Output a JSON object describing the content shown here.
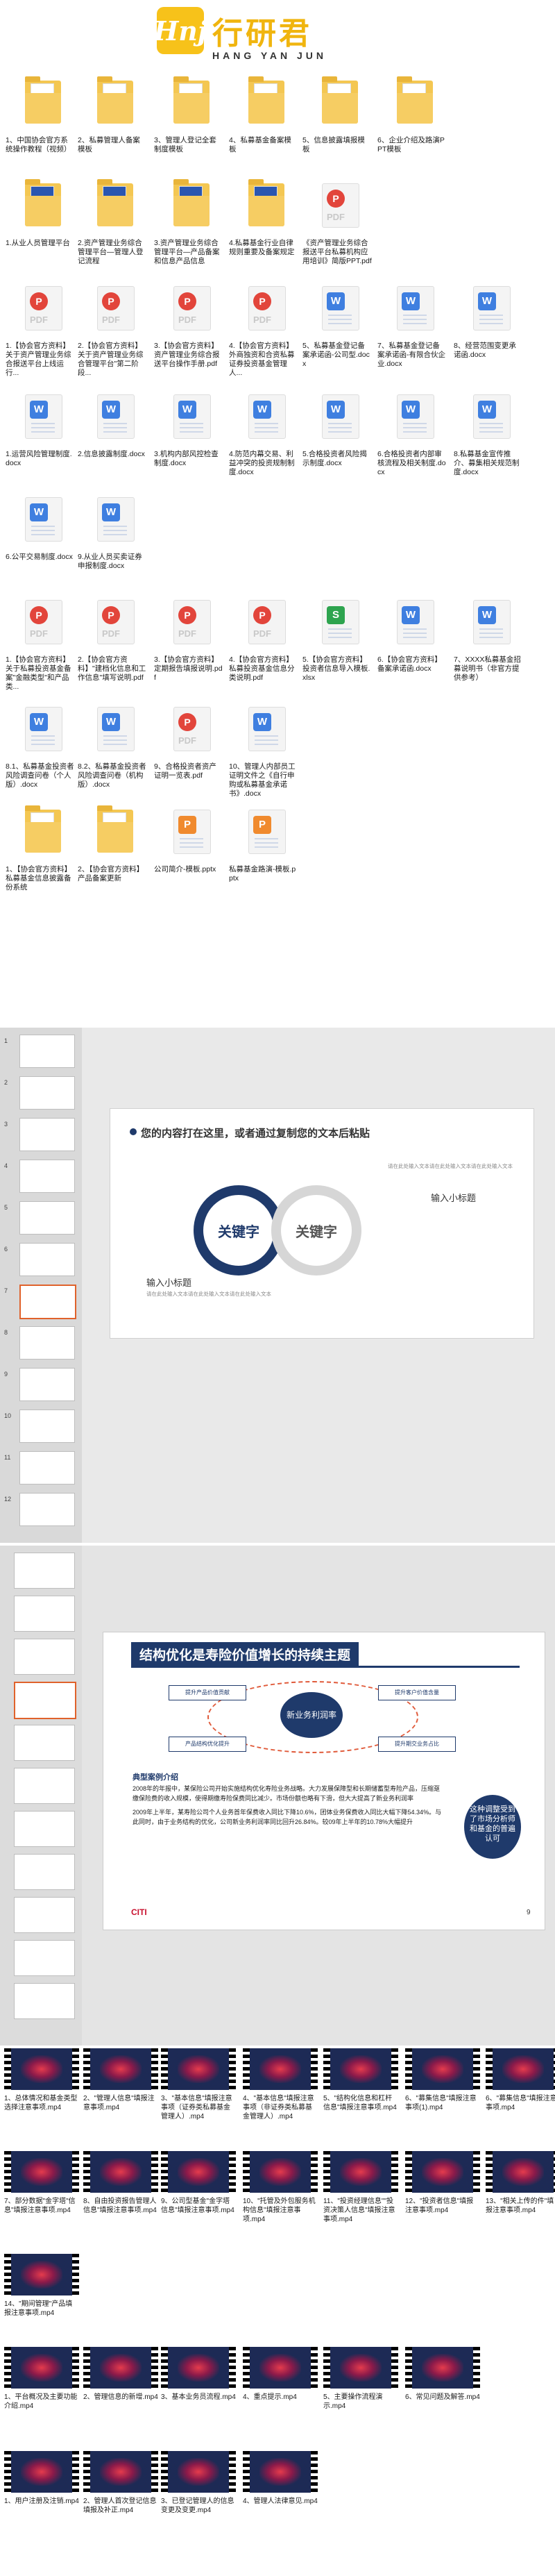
{
  "header": {
    "logo_mark": "Hnj",
    "brand_cn": "行研君",
    "brand_en": "HANG YAN JUN"
  },
  "files": [
    {
      "type": "folder",
      "label": "1、中国协会官方系统操作教程（视频）"
    },
    {
      "type": "folder",
      "label": "2、私募管理人备案模板"
    },
    {
      "type": "folder",
      "label": "3、管理人登记全套制度模板"
    },
    {
      "type": "folder",
      "label": "4、私募基金备案模板"
    },
    {
      "type": "folder",
      "label": "5、信息披露填报模板"
    },
    {
      "type": "folder",
      "label": "6、企业介绍及路演PPT模板"
    },
    {
      "type": "folder-blue",
      "label": "1.从业人员管理平台"
    },
    {
      "type": "folder-blue",
      "label": "2.资产管理业务综合管理平台—管理人登记流程"
    },
    {
      "type": "folder-blue",
      "label": "3.资产管理业务综合管理平台—产品备案和信息产品信息"
    },
    {
      "type": "folder-blue",
      "label": "4.私募基金行业自律规则重要及备案规定"
    },
    {
      "type": "pdf",
      "label": "《资产管理业务综合报送平台私募机构应用培训》简版PPT.pdf"
    },
    {
      "type": "pdf",
      "label": "1.【协会官方资料】关于资产管理业务综合报送平台上线运行..."
    },
    {
      "type": "pdf",
      "label": "2.【协会官方资料】关于资产管理业务综合管理平台\"第二阶段..."
    },
    {
      "type": "pdf",
      "label": "3.【协会官方资料】资产管理业务综合报送平台操作手册.pdf"
    },
    {
      "type": "pdf",
      "label": "4.【协会官方资料】外商独资和合资私募证券投资基金管理人..."
    },
    {
      "type": "doc",
      "label": "5、私募基金登记备案承诺函-公司型.docx"
    },
    {
      "type": "doc",
      "label": "7、私募基金登记备案承诺函-有限合伙企业.docx"
    },
    {
      "type": "doc",
      "label": "8、经营范围变更承诺函.docx"
    },
    {
      "type": "doc",
      "label": "1.运营风险管理制度.docx"
    },
    {
      "type": "doc",
      "label": "2.信息披露制度.docx"
    },
    {
      "type": "doc",
      "label": "3.机构内部风控检查制度.docx"
    },
    {
      "type": "doc",
      "label": "4.防范内幕交易、利益冲突的投资规制制度.docx"
    },
    {
      "type": "doc",
      "label": "5.合格投资者风险揭示制度.docx"
    },
    {
      "type": "doc",
      "label": "6.合格投资者内部审核流程及相关制度.docx"
    },
    {
      "type": "doc",
      "label": "8.私募基金宣传推介、募集相关规范制度.docx"
    },
    {
      "type": "doc",
      "label": "6.公平交易制度.docx"
    },
    {
      "type": "doc",
      "label": "9.从业人员买卖证券申报制度.docx"
    },
    {
      "type": "pdf",
      "label": "1.【协会官方资料】关于私募投资基金备案\"金融类型\"和产品类..."
    },
    {
      "type": "pdf",
      "label": "2.【协会官方资料】\"建档化信息和工作信息\"填写说明.pdf"
    },
    {
      "type": "pdf",
      "label": "3.【协会官方资料】定期报告填报说明.pdf"
    },
    {
      "type": "pdf",
      "label": "4.【协会官方资料】私募投资基金信息分类说明.pdf"
    },
    {
      "type": "xls",
      "label": "5.【协会官方资料】投资者信息导入模板.xlsx"
    },
    {
      "type": "doc",
      "label": "6.【协会官方资料】备案承诺函.docx"
    },
    {
      "type": "doc",
      "label": "7、XXXX私募基金招募说明书（非官方提供参考）"
    },
    {
      "type": "doc",
      "label": "8.1、私募基金投资者风险调查问卷（个人版）.docx"
    },
    {
      "type": "doc",
      "label": "8.2、私募基金投资者风险调查问卷（机构版）.docx"
    },
    {
      "type": "pdf",
      "label": "9、合格投资者资产证明一览表.pdf"
    },
    {
      "type": "doc",
      "label": "10、管理人内部员工证明文件之《自行申购或私募基金承诺书》.docx"
    },
    {
      "type": "folder",
      "label": "1、【协会官方资料】私募基金信息披露备份系统"
    },
    {
      "type": "folder",
      "label": "2、【协会官方资料】产品备案更新"
    },
    {
      "type": "ppt",
      "label": "公司简介-模板.pptx"
    },
    {
      "type": "ppt",
      "label": "私募基金路演-模板.pptx"
    }
  ],
  "shot2": {
    "slide_title": "您的内容打在这里，或者通过复制您的文本后粘贴",
    "keyword1": "关键字",
    "keyword2": "关键字",
    "sub_right": "输入小标题",
    "sub_left": "输入小标题",
    "filler": "请在此处输入文本请在此处输入文本请在此处输入文本",
    "thumbs": [
      "1",
      "2",
      "3",
      "4",
      "5",
      "6",
      "7",
      "8",
      "9",
      "10",
      "11",
      "12"
    ]
  },
  "shot3": {
    "slide_title": "结构优化是寿险价值增长的持续主题",
    "hub": "新业务利润率",
    "box_tl": "提升产品价值贡献",
    "box_bl": "产品结构优化提升",
    "box_tr": "提升客户价值含量",
    "box_br": "提升期交业务占比",
    "case_title": "典型案例介绍",
    "case_p1": "2008年的年报中，某保险公司开始实施结构优化寿险业务战略。大力发展保障型和长期储蓄型寿险产品，压缩趸缴保险费的收入规模，使得期缴寿险保费同比减少。市场份额也略有下滑，但大大提高了新业务利润率",
    "case_p2": "2009年上半年，某寿险公司个人业务首年保费收入同比下降10.6%，团体业务保费收入同比大幅下降54.34%。与此同时，由于业务结构的优化，公司新业务利润率同比回升26.84%。较09年上半年的10.78%大幅提升",
    "logo": "CITI",
    "page_no": "9",
    "callout": "这种调整受到了市场分析师和基金的普遍认可"
  },
  "videos": [
    "1、总体情况和基金类型选择注意事项.mp4",
    "2、\"管理人信息\"填报注意事项.mp4",
    "3、\"基本信息\"填报注意事项（证券类私募基金管理人）.mp4",
    "4、\"基本信息\"填报注意事项（非证券类私募基金管理人）.mp4",
    "5、\"结构化信息和杠杆信息\"填报注意事项.mp4",
    "6、\"募集信息\"填报注意事项(1).mp4",
    "6、\"募集信息\"填报注意事项.mp4",
    "7、部分数据\"金字塔\"信息\"填报注意事项.mp4",
    "8、自由投资报告管理人信息\"填报注意事项.mp4",
    "9、公司型基金\"金字塔信息\"填报注意事项.mp4",
    "10、\"托管及外包服务机构信息\"填报注意事项.mp4",
    "11、\"投资经理信息\"\"投资决策人信息\"填报注意事项.mp4",
    "12、\"投资者信息\"填报注意事项.mp4",
    "13、\"相关上传的件\"填报注意事项.mp4",
    "14、\"期间管理\"产品填报注意事项.mp4",
    "1、平台概况及主要功能介绍.mp4",
    "2、管理信息的新增.mp4",
    "3、基本业务员流程.mp4",
    "4、重点提示.mp4",
    "5、主要操作流程演示.mp4",
    "6、常见问题及解答.mp4",
    "1、用户注册及注销.mp4",
    "2、管理人首次登记信息填报及补正.mp4",
    "3、已登记管理人的信息变更及变更.mp4",
    "4、管理人法律意见.mp4"
  ]
}
